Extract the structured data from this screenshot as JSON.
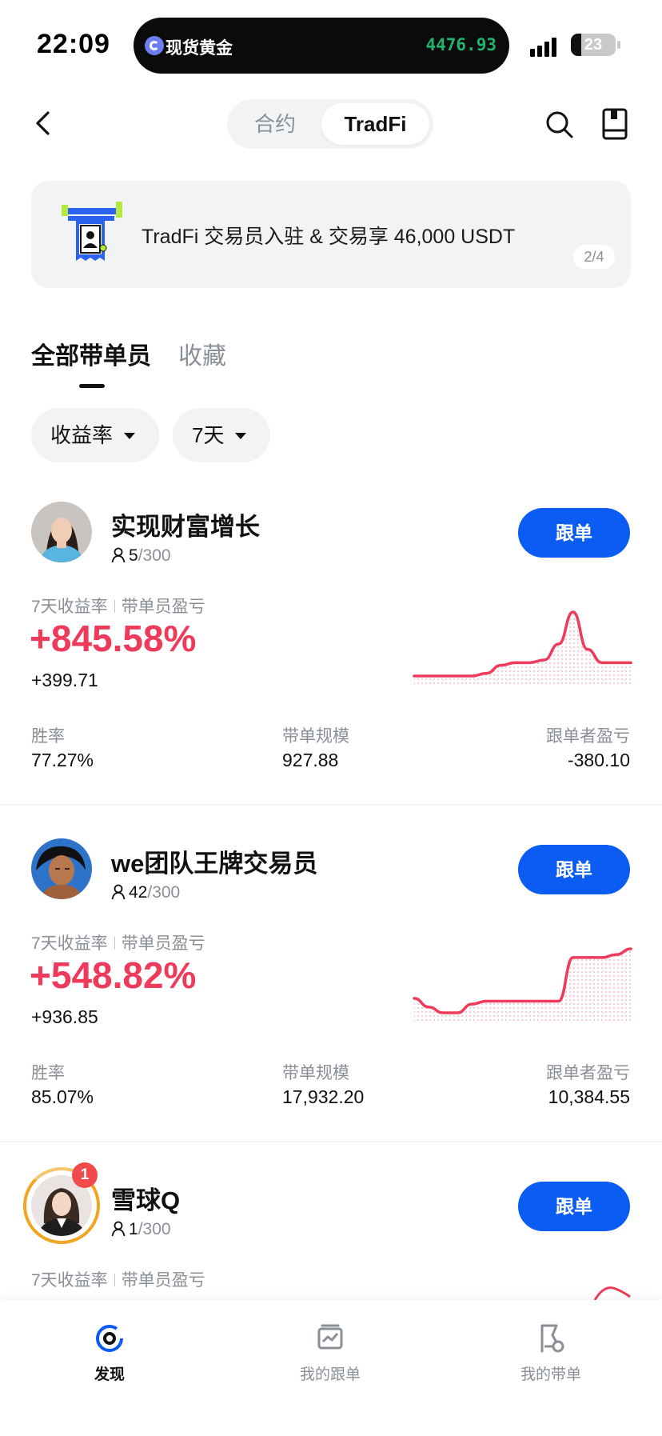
{
  "status_bar": {
    "time": "22:09",
    "live_activity_label": "现货黄金",
    "live_activity_value": "4476.93",
    "battery": "23",
    "battery_level": 0.23
  },
  "header": {
    "tabs": [
      {
        "label": "合约",
        "active": false
      },
      {
        "label": "TradFi",
        "active": true
      }
    ]
  },
  "banner": {
    "text": "TradFi 交易员入驻 & 交易享 46,000 USDT",
    "pager": "2/4"
  },
  "list_tabs": [
    {
      "label": "全部带单员",
      "active": true
    },
    {
      "label": "收藏",
      "active": false
    }
  ],
  "filters": {
    "sort": "收益率",
    "period": "7天"
  },
  "colors": {
    "accent_blue": "#0a5cf2",
    "profit_red": "#ee3b5c",
    "muted_gray": "#8a8f96",
    "island_green": "#1fb36b"
  },
  "traders": [
    {
      "name": "实现财富增长",
      "followers": "5",
      "followers_cap": "/300",
      "follow_label": "跟单",
      "metric_label_1": "7天收益率",
      "metric_label_2": "带单员盈亏",
      "roi": "+845.58%",
      "pnl": "+399.71",
      "win_rate_label": "胜率",
      "win_rate": "77.27%",
      "aum_label": "带单规模",
      "aum": "927.88",
      "follower_pnl_label": "跟单者盈亏",
      "follower_pnl": "-380.10",
      "sparkline": [
        0,
        0,
        0,
        0,
        0,
        0.5,
        2,
        2.5,
        2.5,
        3,
        6,
        12,
        5,
        2.5,
        2.5,
        2.5
      ]
    },
    {
      "name": "we团队王牌交易员",
      "followers": "42",
      "followers_cap": "/300",
      "follow_label": "跟单",
      "metric_label_1": "7天收益率",
      "metric_label_2": "带单员盈亏",
      "roi": "+548.82%",
      "pnl": "+936.85",
      "win_rate_label": "胜率",
      "win_rate": "85.07%",
      "aum_label": "带单规模",
      "aum": "17,932.20",
      "follower_pnl_label": "跟单者盈亏",
      "follower_pnl": "10,384.55",
      "sparkline": [
        3,
        1.5,
        0.5,
        0.5,
        2,
        2.5,
        2.5,
        2.5,
        2.5,
        2.5,
        2.5,
        10,
        10,
        10,
        10.5,
        11.5
      ]
    },
    {
      "name": "雪球Q",
      "followers": "1",
      "followers_cap": "/300",
      "follow_label": "跟单",
      "metric_label_1": "7天收益率",
      "metric_label_2": "带单员盈亏",
      "notification_count": "1"
    }
  ],
  "bottom_nav": [
    {
      "label": "发现",
      "active": true,
      "icon": "discover-icon"
    },
    {
      "label": "我的跟单",
      "active": false,
      "icon": "my-copy-icon"
    },
    {
      "label": "我的带单",
      "active": false,
      "icon": "my-lead-icon"
    }
  ]
}
